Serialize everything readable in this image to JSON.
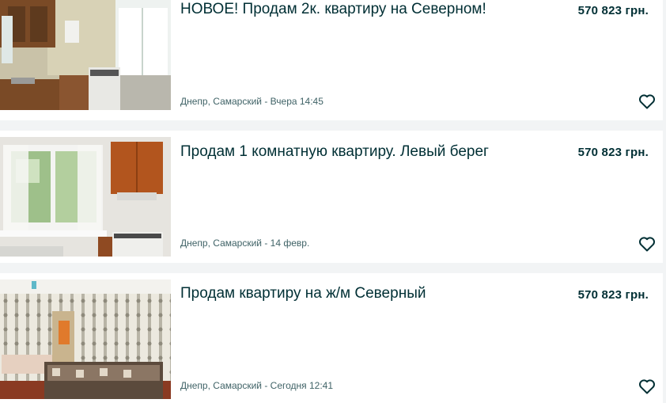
{
  "listings": [
    {
      "title": "НОВОЕ! Продам 2к. квартиру на Северном!",
      "price": "570 823 грн.",
      "location_date": "Днепр, Самарский - Вчера 14:45",
      "favorite_icon": "heart-outline-icon"
    },
    {
      "title": "Продам 1 комнатную квартиру. Левый берег",
      "price": "570 823 грн.",
      "location_date": "Днепр, Самарский - 14 февр.",
      "favorite_icon": "heart-outline-icon"
    },
    {
      "title": "Продам квартиру на ж/м Северный",
      "price": "570 823 грн.",
      "location_date": "Днепр, Самарский - Сегодня 12:41",
      "favorite_icon": "heart-outline-icon"
    }
  ],
  "colors": {
    "text_primary": "#002f34",
    "text_secondary": "#406367",
    "background": "#f2f4f5",
    "card": "#ffffff"
  }
}
